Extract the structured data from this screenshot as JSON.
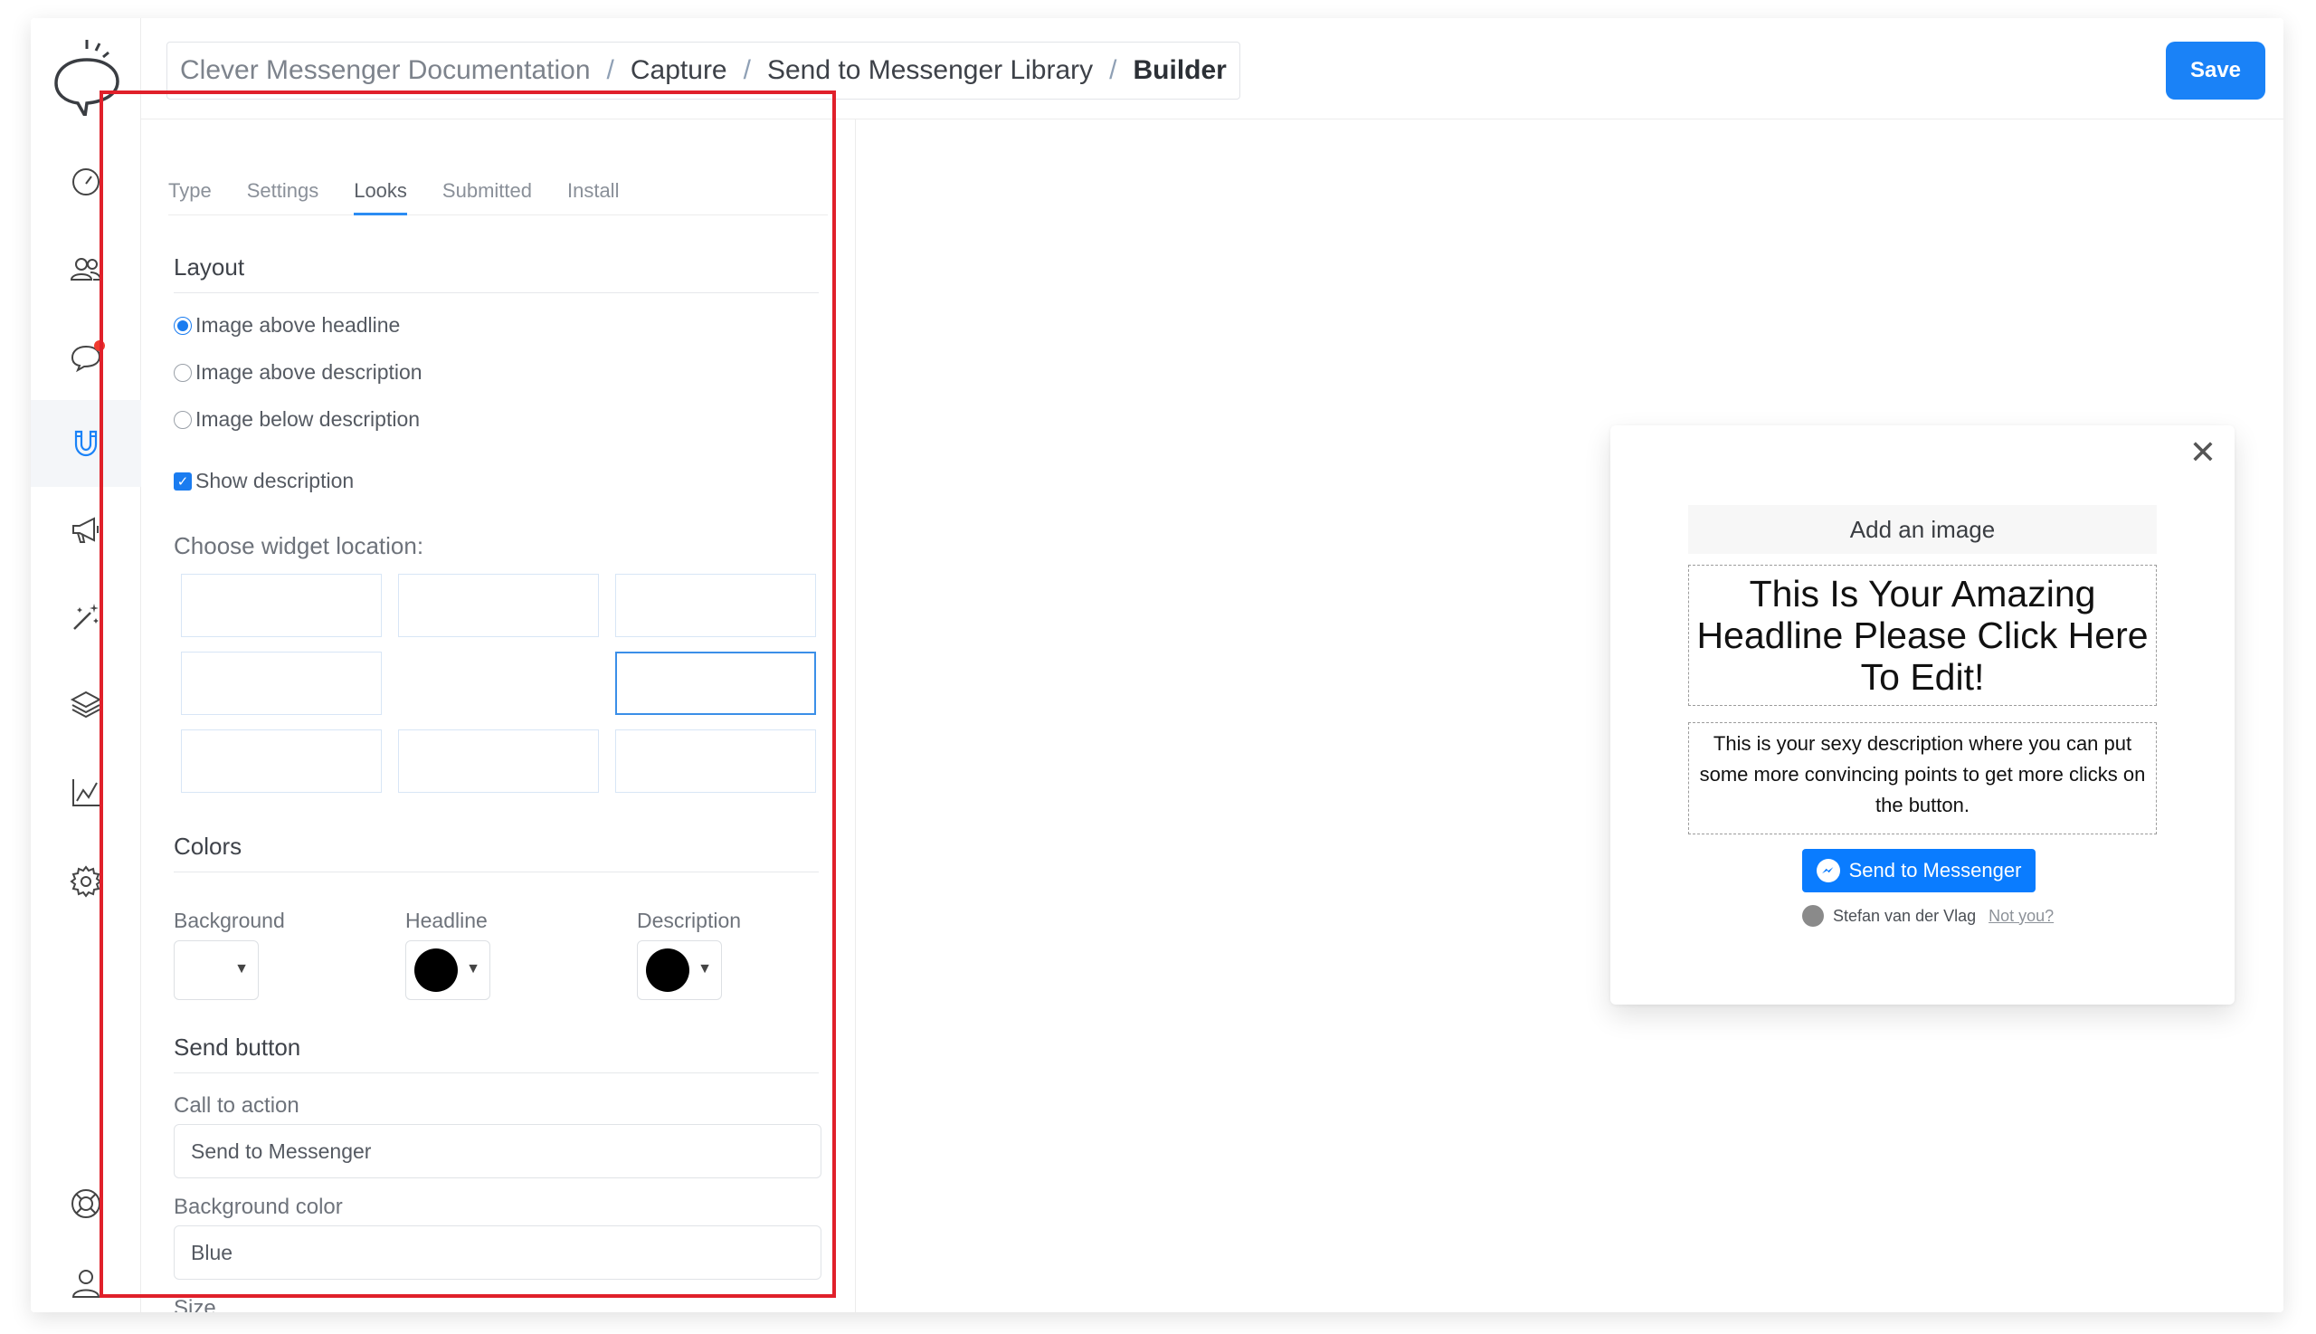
{
  "breadcrumb": [
    "Clever Messenger Documentation",
    "Capture",
    "Send to Messenger Library",
    "Builder"
  ],
  "save_label": "Save",
  "tabs": [
    "Type",
    "Settings",
    "Looks",
    "Submitted",
    "Install"
  ],
  "active_tab": "Looks",
  "layout": {
    "title": "Layout",
    "options": [
      "Image above headline",
      "Image above description",
      "Image below description"
    ],
    "selected": "Image above headline",
    "show_description_label": "Show description",
    "show_description_checked": true
  },
  "widget_location": {
    "label": "Choose widget location:",
    "selected": "middle-right"
  },
  "colors": {
    "title": "Colors",
    "background_label": "Background",
    "background_color": "#ffffff",
    "headline_label": "Headline",
    "headline_color": "#000000",
    "description_label": "Description",
    "description_color": "#000000"
  },
  "send_button": {
    "title": "Send button",
    "cta_label": "Call to action",
    "cta_value": "Send to Messenger",
    "bg_label": "Background color",
    "bg_value": "Blue",
    "size_label": "Size"
  },
  "preview": {
    "add_image": "Add an image",
    "headline": "This Is Your Amazing Headline Please Click Here To Edit!",
    "description": "This is your sexy description where you can put some more convincing points to get more clicks on the button.",
    "button_label": "Send to Messenger",
    "user_name": "Stefan van der Vlag",
    "not_you": "Not you?"
  },
  "accent_color": "#1a82f7",
  "nav_icons": [
    "dashboard-icon",
    "contacts-icon",
    "chat-icon",
    "capture-magnet-icon",
    "broadcast-megaphone-icon",
    "automation-wand-icon",
    "layers-icon",
    "analytics-icon",
    "settings-gear-icon",
    "help-lifebuoy-icon",
    "account-user-icon"
  ]
}
